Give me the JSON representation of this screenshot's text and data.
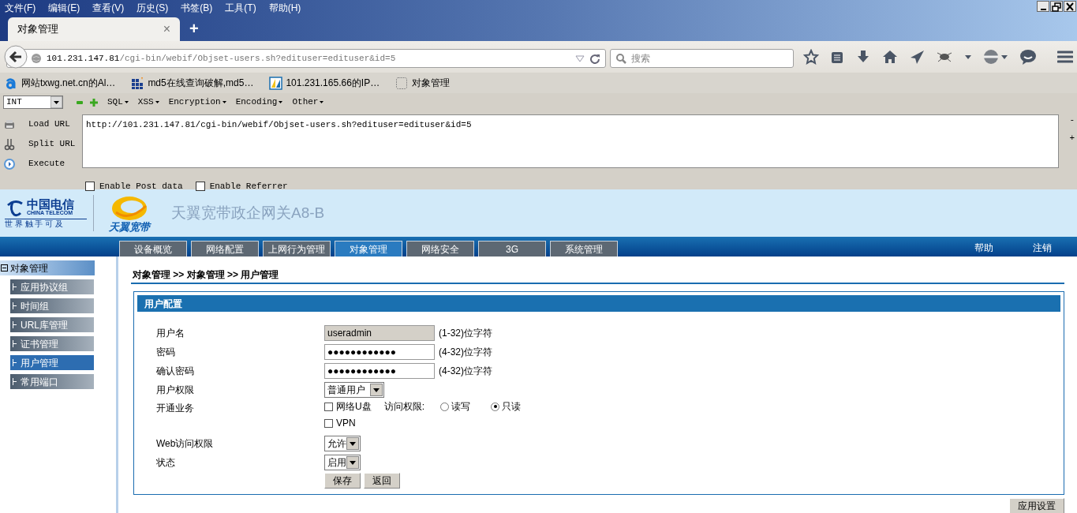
{
  "browser": {
    "menu": [
      "文件(F)",
      "编辑(E)",
      "查看(V)",
      "历史(S)",
      "书签(B)",
      "工具(T)",
      "帮助(H)"
    ],
    "tabs": [
      {
        "title": "对象管理",
        "selected": true,
        "close": "×"
      }
    ],
    "new_tab": "+",
    "url_host": "101.231.147.81",
    "url_path": "/cgi-bin/webif/Objset-users.sh?edituser=edituser&id=5",
    "search": {
      "placeholder": "搜索"
    },
    "bookmarks": [
      {
        "kind": "letter",
        "label": "网站txwg.net.cn的Al…"
      },
      {
        "kind": "grid",
        "label": "md5在线查询破解,md5…"
      },
      {
        "kind": "tile",
        "label": "101.231.165.66的IP…"
      },
      {
        "kind": "blank",
        "label": "对象管理"
      }
    ]
  },
  "hackbar": {
    "select": "INT",
    "menus": [
      "SQL",
      "XSS",
      "Encryption",
      "Encoding",
      "Other"
    ],
    "actions": [
      {
        "kind": "load",
        "label": "Load URL"
      },
      {
        "kind": "split",
        "label": "Split URL"
      },
      {
        "kind": "execute",
        "label": "Execute"
      }
    ],
    "url": "http://101.231.147.81/cgi-bin/webif/Objset-users.sh?edituser=edituser&id=5",
    "options": [
      {
        "label": "Enable Post data",
        "checked": false
      },
      {
        "label": "Enable Referrer",
        "checked": false
      }
    ],
    "side": [
      "-",
      "+"
    ]
  },
  "page": {
    "logo": {
      "name": "中国电信",
      "english": "CHINA TELECOM",
      "slogan": "世 界 触 手 可 及",
      "brand": "天翼宽带"
    },
    "title": "天翼宽带政企网关A8-B",
    "nav": [
      {
        "label": "设备概览",
        "selected": false
      },
      {
        "label": "网络配置",
        "selected": false
      },
      {
        "label": "上网行为管理",
        "selected": false
      },
      {
        "label": "对象管理",
        "selected": true
      },
      {
        "label": "网络安全",
        "selected": false
      },
      {
        "label": "3G",
        "selected": false
      },
      {
        "label": "系统管理",
        "selected": false
      }
    ],
    "links": [
      "帮助",
      "注销"
    ],
    "sidebar": {
      "items": [
        {
          "label": "对象管理",
          "expanded": true,
          "children": [
            {
              "label": "应用协议组",
              "selected": false
            },
            {
              "label": "时间组",
              "selected": false
            },
            {
              "label": "URL库管理",
              "selected": false
            },
            {
              "label": "证书管理",
              "selected": false
            },
            {
              "label": "用户管理",
              "selected": true
            },
            {
              "label": "常用端口",
              "selected": false
            }
          ]
        }
      ]
    },
    "breadcrumb": "对象管理 >> 对象管理 >> 用户管理",
    "form": {
      "title": "用户配置",
      "rows": [
        {
          "kind": "text",
          "label": "用户名",
          "value": "useradmin",
          "disabled": true,
          "hint": "(1-32)位字符"
        },
        {
          "kind": "text",
          "label": "密码",
          "value": "●●●●●●●●●●●●",
          "disabled": false,
          "hint": "(4-32)位字符"
        },
        {
          "kind": "text",
          "label": "确认密码",
          "value": "●●●●●●●●●●●●",
          "disabled": false,
          "hint": "(4-32)位字符"
        },
        {
          "kind": "select",
          "label": "用户权限",
          "value": "普通用户"
        },
        {
          "kind": "services",
          "label": "开通业务",
          "checks": [
            {
              "label": "网络U盘",
              "checked": false
            },
            {
              "label": "VPN",
              "checked": false
            }
          ],
          "access_label": "访问权限:",
          "radios": [
            {
              "label": "读写",
              "selected": false
            },
            {
              "label": "只读",
              "selected": true
            }
          ]
        },
        {
          "kind": "select",
          "label": "Web访问权限",
          "value": "允许"
        },
        {
          "kind": "select",
          "label": "状态",
          "value": "启用"
        }
      ],
      "buttons": [
        "保存",
        "返回"
      ]
    },
    "apply": "应用设置"
  }
}
